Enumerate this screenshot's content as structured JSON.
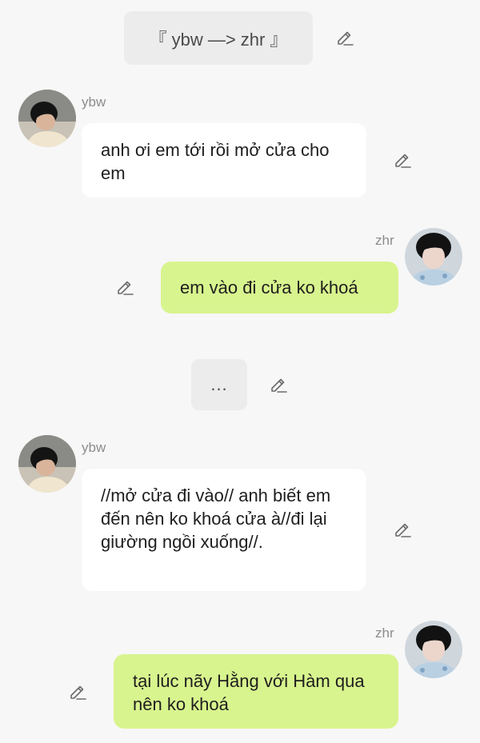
{
  "header": {
    "title": "『 ybw —> zhr 』"
  },
  "messages": [
    {
      "sender": "ybw",
      "side": "left",
      "text": "anh ơi em tới rồi mở cửa cho em"
    },
    {
      "sender": "zhr",
      "side": "right",
      "text": "em vào đi cửa ko khoá"
    },
    {
      "sender": "ybw",
      "side": "left",
      "text": "//mở cửa đi vào// anh biết em đến nên ko khoá cửa à//đi lại giường ngồi xuống//."
    },
    {
      "sender": "zhr",
      "side": "right",
      "text": "tại lúc nãy Hằng với Hàm qua nên ko khoá"
    }
  ],
  "ellipsis": "...",
  "icons": {
    "edit": "pencil-edit-icon",
    "avatar_ybw": "avatar-ybw",
    "avatar_zhr": "avatar-zhr"
  },
  "colors": {
    "background": "#f7f7f7",
    "left_bubble": "#ffffff",
    "right_bubble": "#d8f48e",
    "system_pill": "#ececec",
    "sender_name": "#8c8c8c",
    "icon": "#6b6b6b"
  }
}
